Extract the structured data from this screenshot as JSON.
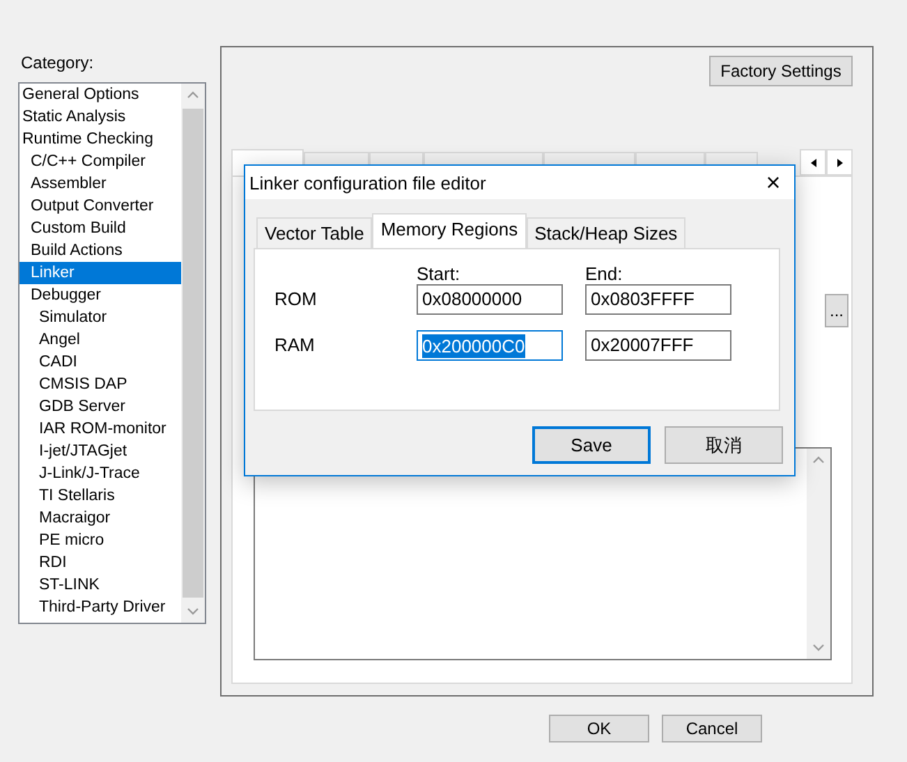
{
  "category": {
    "label": "Category:",
    "items": [
      {
        "label": "General Options",
        "selected": false
      },
      {
        "label": "Static Analysis",
        "selected": false
      },
      {
        "label": "Runtime Checking",
        "selected": false,
        "children": [
          {
            "label": "C/C++ Compiler",
            "selected": false
          },
          {
            "label": "Assembler",
            "selected": false
          },
          {
            "label": "Output Converter",
            "selected": false
          },
          {
            "label": "Custom Build",
            "selected": false
          },
          {
            "label": "Build Actions",
            "selected": false
          },
          {
            "label": "Linker",
            "selected": true
          },
          {
            "label": "Debugger",
            "selected": false,
            "children": [
              {
                "label": "Simulator",
                "selected": false
              },
              {
                "label": "Angel",
                "selected": false
              },
              {
                "label": "CADI",
                "selected": false
              },
              {
                "label": "CMSIS DAP",
                "selected": false
              },
              {
                "label": "GDB Server",
                "selected": false
              },
              {
                "label": "IAR ROM-monitor",
                "selected": false
              },
              {
                "label": "I-jet/JTAGjet",
                "selected": false
              },
              {
                "label": "J-Link/J-Trace",
                "selected": false
              },
              {
                "label": "TI Stellaris",
                "selected": false
              },
              {
                "label": "Macraigor",
                "selected": false
              },
              {
                "label": "PE micro",
                "selected": false
              },
              {
                "label": "RDI",
                "selected": false
              },
              {
                "label": "ST-LINK",
                "selected": false
              },
              {
                "label": "Third-Party Driver",
                "selected": false
              }
            ]
          }
        ]
      }
    ]
  },
  "options_panel": {
    "factory_button": "Factory Settings",
    "tabs": [
      {
        "selected": true
      },
      {
        "selected": false
      },
      {
        "selected": false
      },
      {
        "selected": false
      },
      {
        "selected": false
      },
      {
        "selected": false
      },
      {
        "selected": false
      }
    ],
    "browse_button": "..."
  },
  "dialog": {
    "title": "Linker configuration file editor",
    "close": "×",
    "tabs": [
      {
        "label": "Vector Table",
        "selected": false
      },
      {
        "label": "Memory Regions",
        "selected": true
      },
      {
        "label": "Stack/Heap Sizes",
        "selected": false
      }
    ],
    "start_label": "Start:",
    "end_label": "End:",
    "regions": [
      {
        "name": "ROM",
        "start": {
          "value": "0x08000000",
          "text_selected": false
        },
        "end": {
          "value": "0x0803FFFF",
          "text_selected": false
        }
      },
      {
        "name": "RAM",
        "start": {
          "value": "0x200000C0",
          "text_selected": true
        },
        "end": {
          "value": "0x20007FFF",
          "text_selected": false
        }
      }
    ],
    "buttons": [
      {
        "label": "Save",
        "focused": true
      },
      {
        "label": "取消",
        "focused": false
      }
    ]
  },
  "buttons": [
    {
      "label": "OK"
    },
    {
      "label": "Cancel"
    }
  ]
}
